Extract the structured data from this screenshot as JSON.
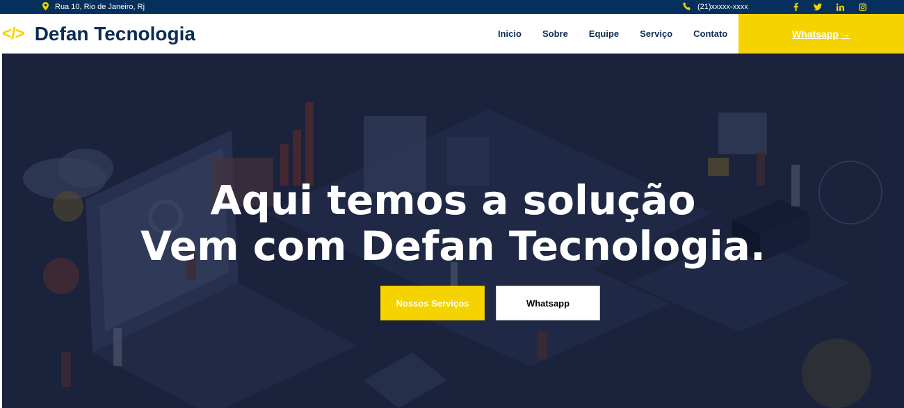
{
  "topbar": {
    "address": "Rua 10, Rio de Janeiro, Rj",
    "phone": "(21)xxxxx-xxxx",
    "social": [
      "f",
      "t",
      "in",
      "ig"
    ]
  },
  "header": {
    "logo_symbol": "</>",
    "brand": "Defan Tecnologia",
    "nav": [
      "Inicio",
      "Sobre",
      "Equipe",
      "Serviço",
      "Contato"
    ],
    "cta_label": "Whatsapp",
    "cta_arrow": "→"
  },
  "hero": {
    "headline_1": "Aqui temos a solução",
    "headline_2": "Vem com Defan Tecnologia.",
    "primary_button": "Nossos Serviços",
    "secondary_button": "Whatsapp"
  },
  "colors": {
    "topbar": "#06305c",
    "accent": "#f5d300",
    "brand_text": "#0b2d55",
    "hero_bg": "#1a2440"
  }
}
